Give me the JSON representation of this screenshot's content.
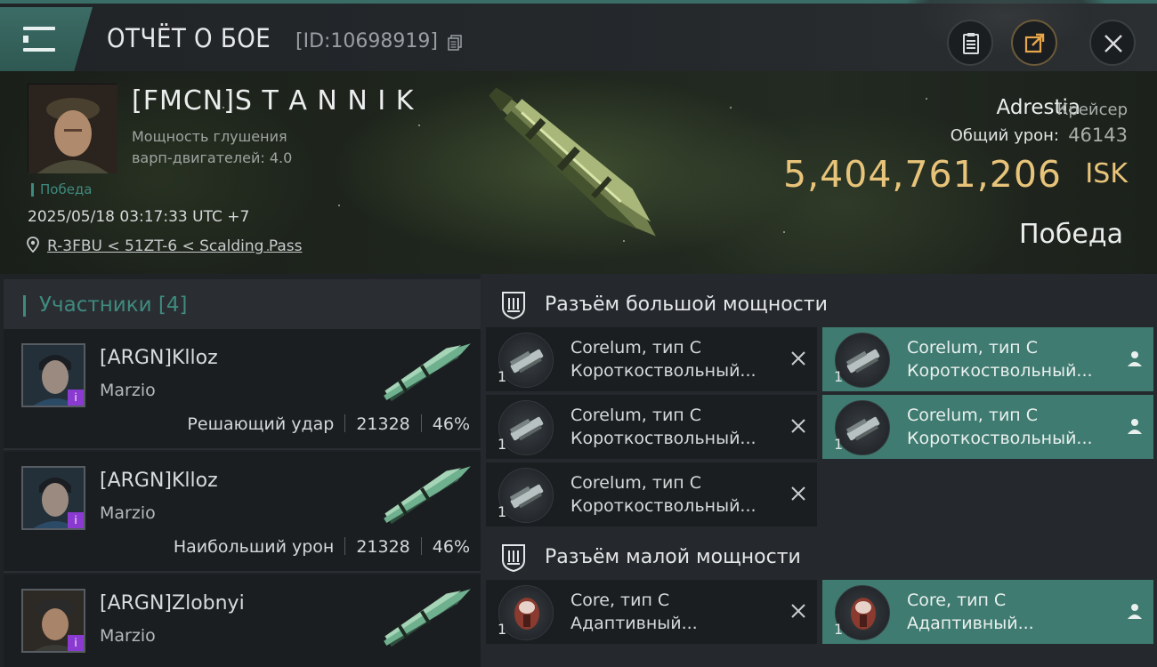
{
  "header": {
    "title": "ОТЧЁТ О БОЕ",
    "battle_id": "[ID:10698919]"
  },
  "victim": {
    "name": "[FMCN]S T A N N I K",
    "stat_line1": "Мощность глушения",
    "stat_line2": "варп-двигателей: 4.0",
    "victory_tag": "Победа",
    "datetime": "2025/05/18 03:17:33 UTC +7",
    "location": "R-3FBU < 51ZT-6 < Scalding Pass",
    "ship_name": "Adrestia",
    "ship_class": "Крейсер",
    "damage_label": "Общий урон:",
    "damage_value": "46143",
    "isk_value": "5,404,761,206",
    "isk_unit": "ISK",
    "result": "Победа"
  },
  "participants": {
    "header": "Участники [4]",
    "rows": [
      {
        "name": "[ARGN]Klloz",
        "corp": "Marzio",
        "label": "Решающий удар",
        "damage": "21328",
        "percent": "46%"
      },
      {
        "name": "[ARGN]Klloz",
        "corp": "Marzio",
        "label": "Наибольший урон",
        "damage": "21328",
        "percent": "46%"
      },
      {
        "name": "[ARGN]Zlobnyi",
        "corp": "Marzio"
      }
    ]
  },
  "fitting": {
    "high_slot_title": "Разъём большой мощности",
    "low_slot_title": "Разъём малой мощности",
    "high_modules": [
      {
        "qty": "1",
        "name": "Corelum, тип С",
        "sub": "Коротк­оствольный...",
        "status": "destroyed"
      },
      {
        "qty": "1",
        "name": "Corelum, тип С",
        "sub": "Короткоствольный...",
        "status": "dropped"
      },
      {
        "qty": "1",
        "name": "Corelum, тип С",
        "sub": "Короткоствольный...",
        "status": "destroyed"
      },
      {
        "qty": "1",
        "name": "Corelum, тип С",
        "sub": "Короткоствольный...",
        "status": "dropped"
      },
      {
        "qty": "1",
        "name": "Corelum, тип С",
        "sub": "Короткоствольный...",
        "status": "destroyed"
      }
    ],
    "low_modules": [
      {
        "qty": "1",
        "name": "Core, тип С",
        "sub": "Адаптивный...",
        "status": "destroyed"
      },
      {
        "qty": "1",
        "name": "Core, тип С",
        "sub": "Адаптивный...",
        "status": "dropped"
      }
    ]
  },
  "colors": {
    "accent": "#3f8a7e",
    "isk": "#e8c47a",
    "dropped_bg": "#3f7b71",
    "badge": "#8a3ad0"
  },
  "icons": [
    "menu-icon",
    "copy-icon",
    "clipboard-icon",
    "share-icon",
    "close-icon",
    "location-pin-icon",
    "slot-icon",
    "destroyed-x-icon",
    "pilot-icon"
  ]
}
